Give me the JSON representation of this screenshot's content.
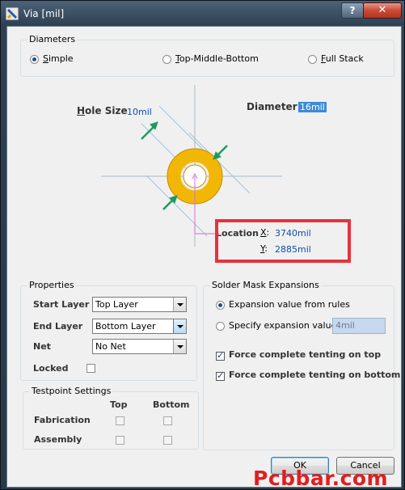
{
  "window": {
    "title": "Via [mil]",
    "help_label": "?",
    "close_label": "✕"
  },
  "diameters": {
    "label": "Diameters",
    "options": [
      {
        "label": "Simple",
        "selected": true
      },
      {
        "label": "Top-Middle-Bottom",
        "selected": false
      },
      {
        "label": "Full Stack",
        "selected": false
      }
    ]
  },
  "diagram": {
    "hole_size_label": "Hole Size",
    "hole_size_value": "10mil",
    "diameter_label": "Diameter",
    "diameter_value": "16mil",
    "location_label": "Location",
    "x_label": "X:",
    "x_value": "3740mil",
    "y_label": "Y:",
    "y_value": "2885mil",
    "via_color": "#f2b705",
    "arrow_color": "#1e9a5e"
  },
  "properties": {
    "label": "Properties",
    "start_layer_label": "Start Layer",
    "start_layer_value": "Top Layer",
    "end_layer_label": "End Layer",
    "end_layer_value": "Bottom Layer",
    "net_label": "Net",
    "net_value": "No Net",
    "locked_label": "Locked",
    "locked": false
  },
  "solder_mask": {
    "label": "Solder Mask Expansions",
    "from_rules_label": "Expansion value from rules",
    "specify_label": "Specify expansion value",
    "specify_value": "4mil",
    "tent_top_label": "Force complete tenting on top",
    "tent_bottom_label": "Force complete tenting on bottom",
    "tent_top": true,
    "tent_bottom": true
  },
  "testpoint": {
    "label": "Testpoint Settings",
    "col_top": "Top",
    "col_bottom": "Bottom",
    "row_fabrication": "Fabrication",
    "row_assembly": "Assembly"
  },
  "buttons": {
    "ok": "OK",
    "cancel": "Cancel"
  },
  "watermark": "Pcbbar.com",
  "highlight_color": "#e7323b"
}
